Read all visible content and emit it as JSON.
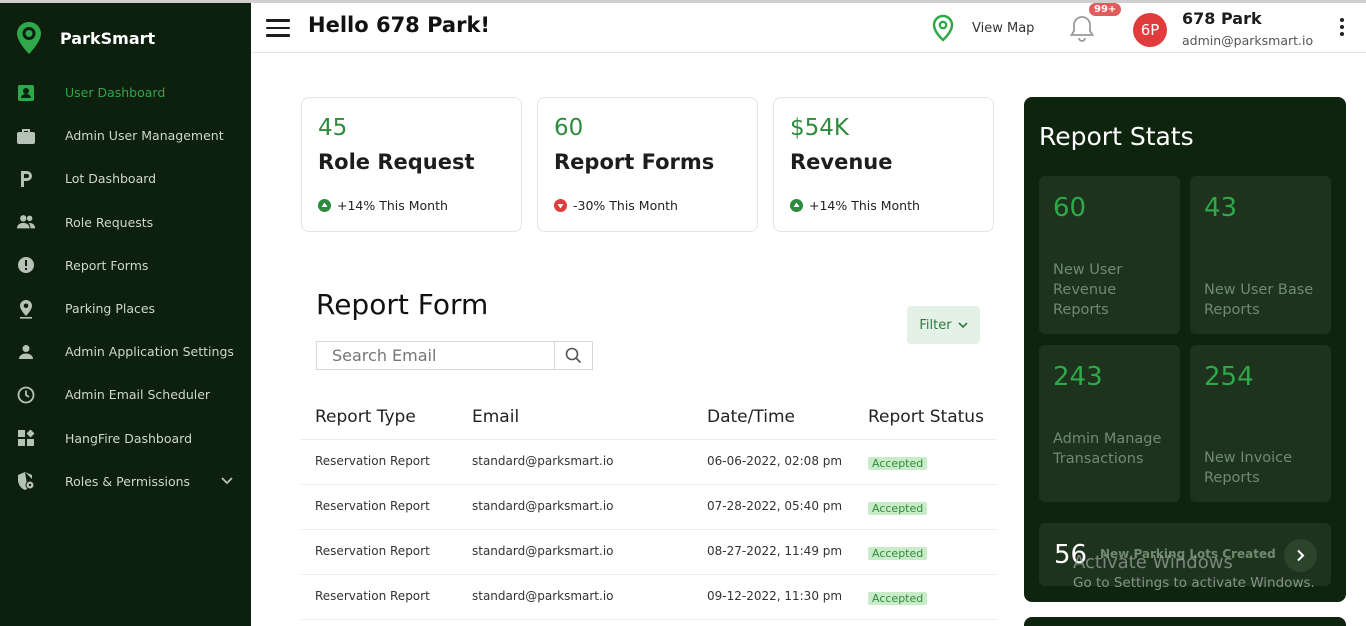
{
  "brand": {
    "name": "ParkSmart",
    "logo": "location-pin-logo"
  },
  "sidebar": {
    "items": [
      {
        "label": "User Dashboard",
        "icon": "id-badge-icon",
        "active": true
      },
      {
        "label": "Admin User Management",
        "icon": "briefcase-icon"
      },
      {
        "label": "Lot Dashboard",
        "icon": "parking-p-icon"
      },
      {
        "label": "Role Requests",
        "icon": "group-icon"
      },
      {
        "label": "Report Forms",
        "icon": "alert-circle-icon"
      },
      {
        "label": "Parking Places",
        "icon": "map-pin-icon"
      },
      {
        "label": "Admin Application Settings",
        "icon": "person-icon"
      },
      {
        "label": "Admin Email Scheduler",
        "icon": "clock-icon"
      },
      {
        "label": "HangFire Dashboard",
        "icon": "widgets-icon"
      },
      {
        "label": "Roles & Permissions",
        "icon": "shield-lock-icon",
        "expandable": true
      }
    ]
  },
  "header": {
    "greeting": "Hello 678 Park!",
    "view_map": "View Map",
    "notifications_badge": "99+",
    "avatar_initials": "6P",
    "user_name": "678 Park",
    "user_email": "admin@parksmart.io"
  },
  "cards": [
    {
      "value": "45",
      "title": "Role Request",
      "trend": "+14% This Month",
      "direction": "up"
    },
    {
      "value": "60",
      "title": "Report Forms",
      "trend": "-30% This Month",
      "direction": "down"
    },
    {
      "value": "$54K",
      "title": "Revenue",
      "trend": "+14% This Month",
      "direction": "up"
    }
  ],
  "report_form": {
    "title": "Report Form",
    "search_placeholder": "Search Email",
    "filter_label": "Filter",
    "columns": [
      "Report Type",
      "Email",
      "Date/Time",
      "Report Status"
    ],
    "rows": [
      {
        "type": "Reservation Report",
        "email": "standard@parksmart.io",
        "datetime": "06-06-2022, 02:08 pm",
        "status": "Accepted"
      },
      {
        "type": "Reservation Report",
        "email": "standard@parksmart.io",
        "datetime": "07-28-2022, 05:40 pm",
        "status": "Accepted"
      },
      {
        "type": "Reservation Report",
        "email": "standard@parksmart.io",
        "datetime": "08-27-2022, 11:49 pm",
        "status": "Accepted"
      },
      {
        "type": "Reservation Report",
        "email": "standard@parksmart.io",
        "datetime": "09-12-2022, 11:30 pm",
        "status": "Accepted"
      }
    ]
  },
  "report_stats": {
    "title": "Report Stats",
    "tiles": [
      {
        "value": "60",
        "label": "New User Revenue Reports"
      },
      {
        "value": "43",
        "label": "New User Base Reports"
      },
      {
        "value": "243",
        "label": "Admin Manage Transactions"
      },
      {
        "value": "254",
        "label": "New Invoice Reports"
      }
    ],
    "wide": {
      "value": "56",
      "label": "New Parking Lots Created"
    }
  },
  "watermark": {
    "line1": "Activate Windows",
    "line2": "Go to Settings to activate Windows."
  },
  "colors": {
    "sidebar_bg": "#0d1f0d",
    "accent": "#2e8b3e",
    "stats_bg": "#0f240f",
    "danger": "#e23b3b"
  }
}
